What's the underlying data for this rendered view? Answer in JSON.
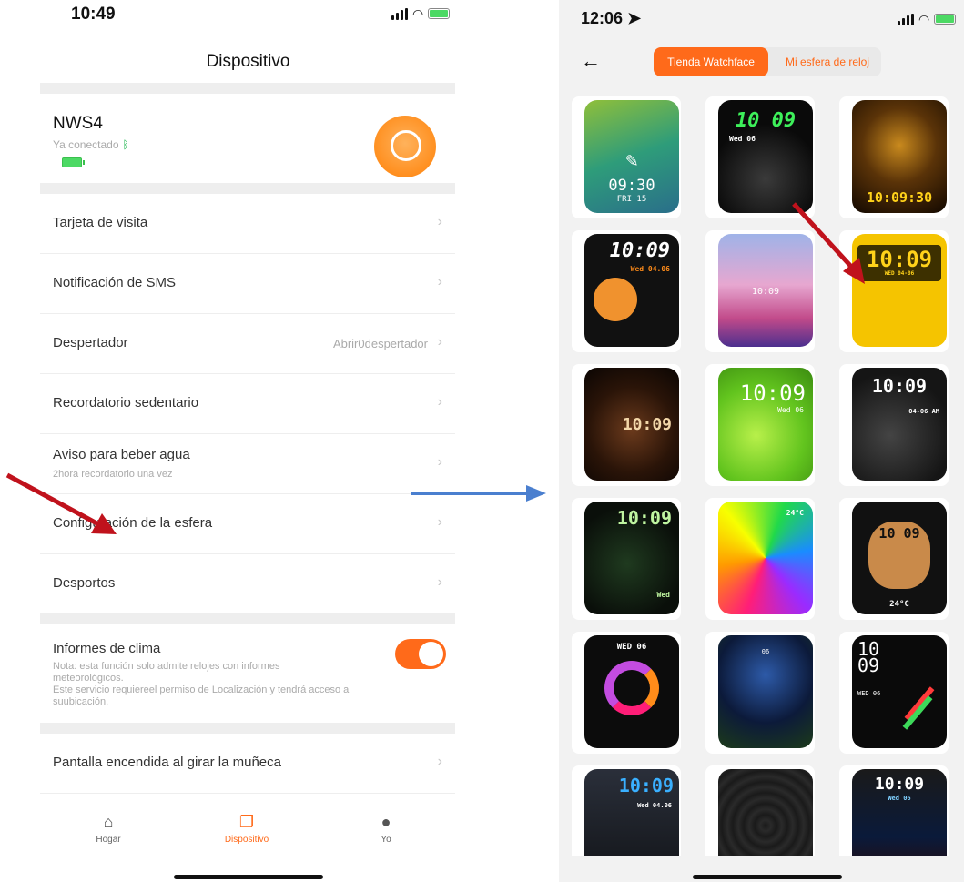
{
  "left_screen": {
    "status_time": "10:49",
    "title": "Dispositivo",
    "device": {
      "name": "NWS4",
      "status": "Ya conectado"
    },
    "menu": [
      {
        "label": "Tarjeta de visita"
      },
      {
        "label": "Notificación de SMS"
      },
      {
        "label": "Despertador",
        "value": "Abrir0despertador"
      },
      {
        "label": "Recordatorio sedentario"
      },
      {
        "label": "Aviso para beber agua",
        "sub": "2hora recordatorio una vez"
      },
      {
        "label": "Configuración de la esfera"
      },
      {
        "label": "Desportos"
      }
    ],
    "weather": {
      "title": "Informes de clima",
      "note": "Nota: esta función solo admite relojes con informes meteorológicos.\nEste servicio requiereel permiso de Localización y tendrá acceso a suubicación."
    },
    "menu_bottom": {
      "label": "Pantalla encendida al girar la muñeca"
    },
    "tabs": [
      {
        "label": "Hogar",
        "icon": "home-icon"
      },
      {
        "label": "Dispositivo",
        "icon": "device-icon"
      },
      {
        "label": "Yo",
        "icon": "person-icon"
      }
    ]
  },
  "right_screen": {
    "status_time": "12:06",
    "tabs": {
      "store": "Tienda Watchface",
      "mine": "Mi esfera de reloj"
    },
    "faces": [
      {
        "time": "09:30",
        "date": "FRI 15"
      },
      {
        "time": "10 09",
        "date": "Wed 06"
      },
      {
        "time": "10:09:30",
        "date": ""
      },
      {
        "time": "10:09",
        "date": "Wed 04.06"
      },
      {
        "time": "10:09",
        "date": ""
      },
      {
        "time": "10:09",
        "date": "WED 04-06"
      },
      {
        "time": "10:09",
        "date": ""
      },
      {
        "time": "10:09",
        "date": "Wed 06"
      },
      {
        "time": "10:09",
        "date": "04-06 AM"
      },
      {
        "time": "10:09",
        "date": "Wed"
      },
      {
        "time": "",
        "date": "24°C"
      },
      {
        "time": "10 09",
        "date": "24°C"
      },
      {
        "time": "",
        "date": "WED 06"
      },
      {
        "time": "",
        "date": "06"
      },
      {
        "time": "10 09",
        "date": "WED 06"
      },
      {
        "time": "10:09",
        "date": "Wed 04.06"
      },
      {
        "time": "",
        "date": ""
      },
      {
        "time": "10:09",
        "date": "Wed 06"
      }
    ]
  },
  "colors": {
    "accent": "#ff6a1a",
    "arrow_red": "#c0121c",
    "arrow_blue": "#4a7fcf"
  }
}
